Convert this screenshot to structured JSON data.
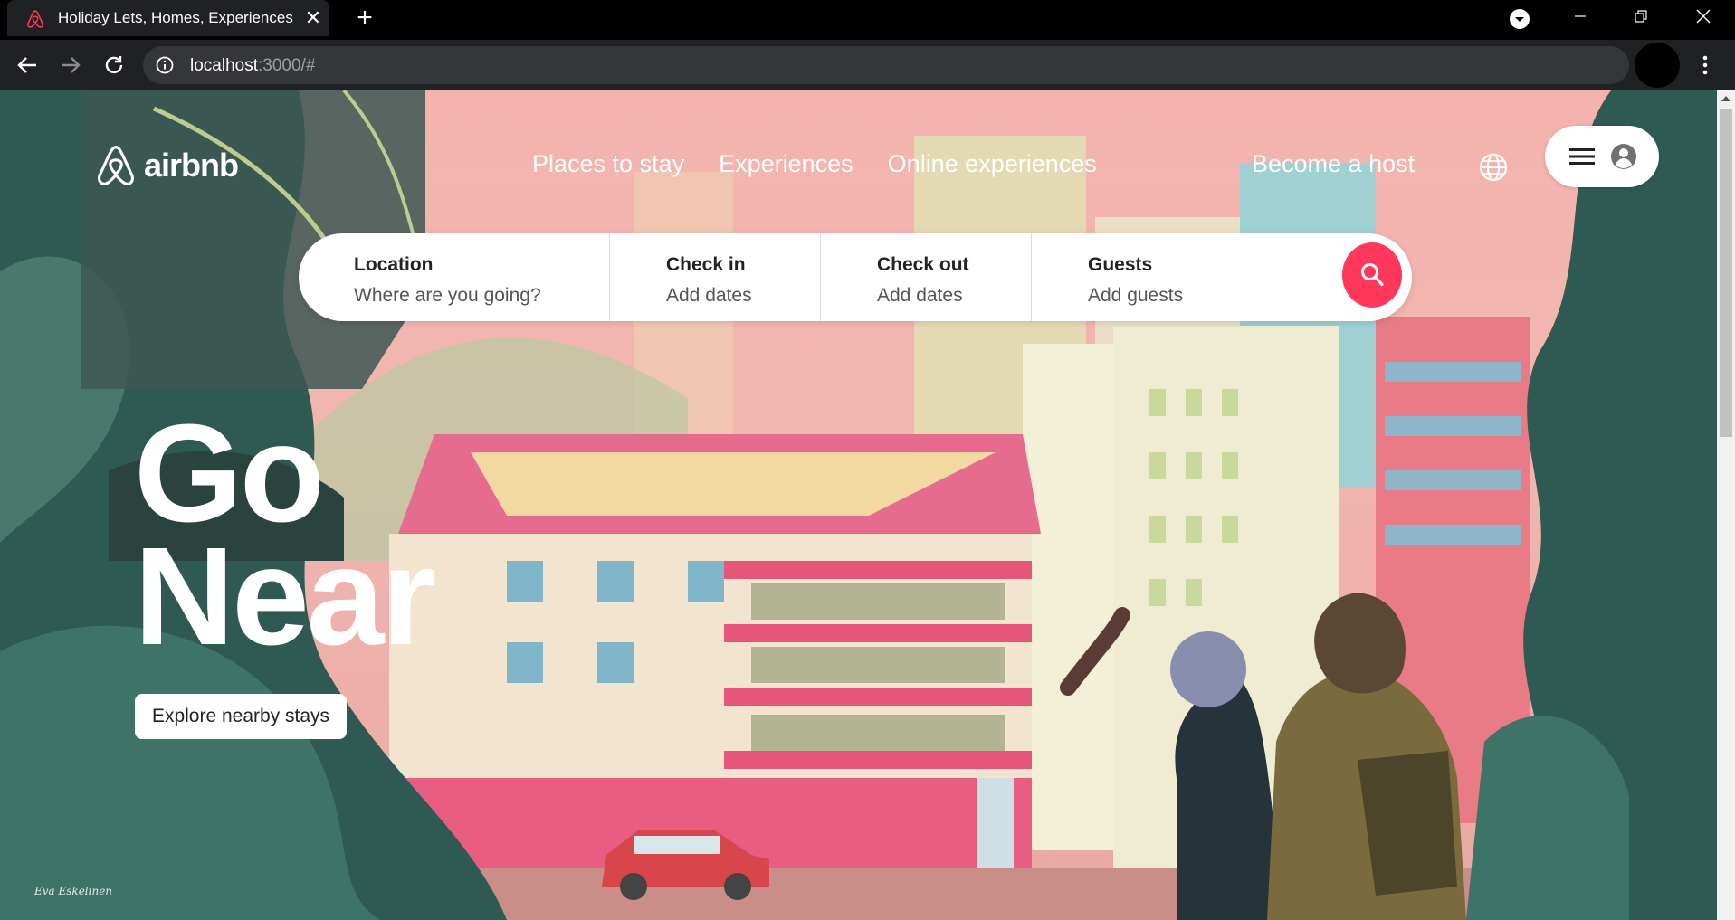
{
  "browser": {
    "tab_title": "Holiday Lets, Homes, Experiences",
    "url_host": "localhost",
    "url_path": ":3000/#",
    "new_tab_symbol": "+",
    "close_symbol": "✕"
  },
  "header": {
    "logo_text": "airbnb",
    "nav": [
      "Places to stay",
      "Experiences",
      "Online experiences"
    ],
    "host_link": "Become a host"
  },
  "search": {
    "fields": [
      {
        "label": "Location",
        "value": "Where are you going?"
      },
      {
        "label": "Check in",
        "value": "Add dates"
      },
      {
        "label": "Check out",
        "value": "Add dates"
      },
      {
        "label": "Guests",
        "value": "Add guests"
      }
    ]
  },
  "hero": {
    "line1": "Go",
    "line2": "Near",
    "cta": "Explore nearby stays",
    "artist_signature": "Eva Eskelinen"
  },
  "colors": {
    "brand": "#ff385c",
    "chrome_bg": "#202124",
    "sky": "#f4b3ae"
  },
  "icons": [
    "airbnb-logo-icon",
    "globe-icon",
    "menu-icon",
    "account-icon",
    "search-icon",
    "back-arrow-icon",
    "forward-arrow-icon",
    "reload-icon",
    "info-icon",
    "star-icon",
    "kebab-menu-icon",
    "profile-dropdown-icon",
    "minimize-icon",
    "restore-icon",
    "window-close-icon"
  ]
}
